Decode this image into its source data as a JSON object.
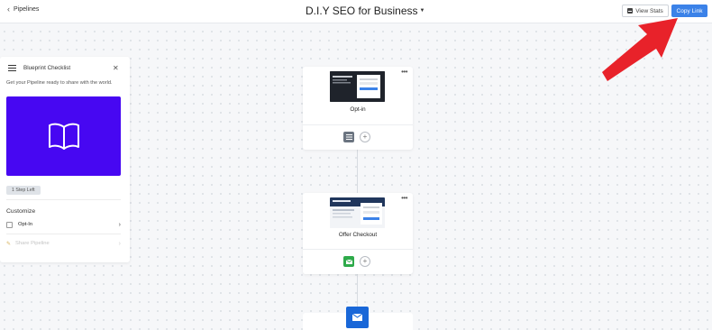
{
  "header": {
    "back_label": "Pipelines",
    "title": "D.I.Y SEO for Business",
    "view_stats_label": "View Stats",
    "copy_link_label": "Copy Link"
  },
  "checklist": {
    "title": "Blueprint Checklist",
    "subtitle": "Get your Pipeline ready to share with the world.",
    "steps_left": "1 Step Left",
    "customize_title": "Customize",
    "items": [
      {
        "label": "Opt-In",
        "enabled": true
      },
      {
        "label": "Share Pipeline",
        "enabled": false
      }
    ]
  },
  "flow": {
    "steps": [
      {
        "name": "Opt-in",
        "badge_icon": "list-icon",
        "badge_color": "#6b7480"
      },
      {
        "name": "Offer Checkout",
        "badge_icon": "email-icon",
        "badge_color": "#2eaa4a"
      }
    ],
    "next_node_icon": "email-icon"
  },
  "colors": {
    "accent": "#3b82e8",
    "hero": "#4707f2",
    "arrow": "#e8222a",
    "email_node": "#1967d8"
  }
}
